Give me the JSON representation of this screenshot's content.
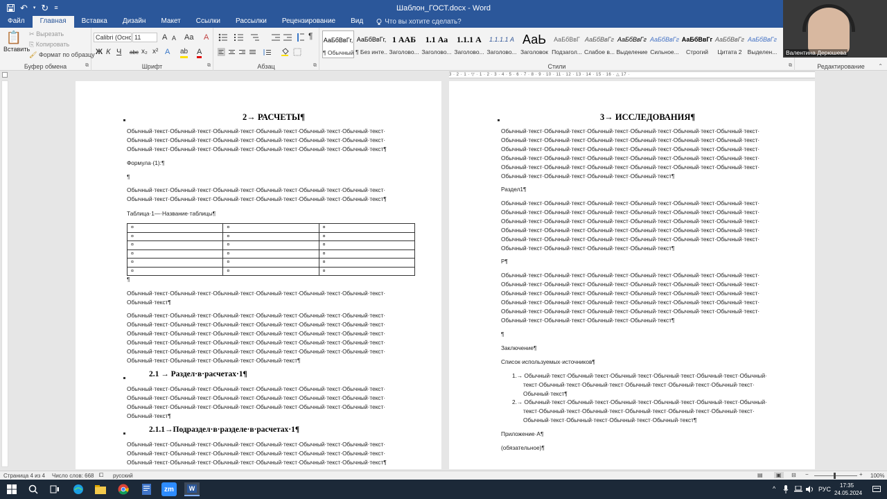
{
  "window": {
    "title": "Шаблон_ГОСТ.docx - Word"
  },
  "qat": {
    "save_icon": "save-icon",
    "undo_icon": "undo-icon",
    "redo_icon": "redo-icon",
    "customize_icon": "customize-icon",
    "undo_glyph": "↶",
    "redo_glyph": "↻",
    "customize_glyph": "≡"
  },
  "tabs": [
    {
      "label": "Файл"
    },
    {
      "label": "Главная"
    },
    {
      "label": "Вставка"
    },
    {
      "label": "Дизайн"
    },
    {
      "label": "Макет"
    },
    {
      "label": "Ссылки"
    },
    {
      "label": "Рассылки"
    },
    {
      "label": "Рецензирование"
    },
    {
      "label": "Вид"
    }
  ],
  "tellme": {
    "text": "Что вы хотите сделать?",
    "icon": "lightbulb-icon"
  },
  "ribbon": {
    "clipboard": {
      "label": "Буфер обмена",
      "paste": "Вставить",
      "cut": "Вырезать",
      "copy": "Копировать",
      "format_painter": "Формат по образцу",
      "paste_glyph": "📋",
      "cut_glyph": "✂",
      "copy_glyph": "⎘",
      "painter_glyph": "🖌"
    },
    "font": {
      "label": "Шрифт",
      "font_name": "Calibri (Осно",
      "font_size": "11",
      "grow": "A",
      "shrink": "A",
      "case": "Aa",
      "clear": "A",
      "bold": "Ж",
      "italic": "К",
      "underline": "Ч",
      "strike": "abc",
      "sub": "x₂",
      "sup": "x²",
      "effects": "A",
      "highlight": "ab",
      "color": "A"
    },
    "paragraph": {
      "label": "Абзац",
      "pilcrow": "¶"
    },
    "styles": {
      "label": "Стили",
      "items": [
        {
          "sample": "АаБбВвГг,",
          "name": "¶ Обычный"
        },
        {
          "sample": "АаБбВвГг,",
          "name": "¶ Без инте..."
        },
        {
          "sample": "1 ААБ",
          "name": "Заголово..."
        },
        {
          "sample": "1.1 Аа",
          "name": "Заголово..."
        },
        {
          "sample": "1.1.1 А",
          "name": "Заголово..."
        },
        {
          "sample": "1.1.1.1 А",
          "name": "Заголово..."
        },
        {
          "sample": "АаЬ",
          "name": "Заголовок"
        },
        {
          "sample": "АаБбВвГ",
          "name": "Подзагол..."
        },
        {
          "sample": "АаБбВвГг",
          "name": "Слабое в..."
        },
        {
          "sample": "АаБбВвГг",
          "name": "Выделение"
        },
        {
          "sample": "АаБбВвГг",
          "name": "Сильное..."
        },
        {
          "sample": "АаБбВвГг",
          "name": "Строгий"
        },
        {
          "sample": "АаБбВвГг",
          "name": "Цитата 2"
        },
        {
          "sample": "АаБбВвГг",
          "name": "Выделен..."
        }
      ]
    },
    "editing": {
      "label": "Редактирование"
    }
  },
  "ruler": {
    "text": "3 · 2 · 1 · ▽ · 1 · 2 · 3 · 4 · 5 · 6 · 7 · 8 · 9 · 10 · 11 · 12 · 13 · 14 · 15 · 16 · △ 17 ·"
  },
  "page1": {
    "heading": "2→ РАСЧЕТЫ¶",
    "p1": [
      "Обычный·текст·Обычный·текст·Обычный·текст·Обычный·текст·Обычный·текст·Обычный·текст·",
      "Обычный·текст·Обычный·текст·Обычный·текст·Обычный·текст·Обычный·текст·Обычный·текст·",
      "Обычный·текст·Обычный·текст·Обычный·текст·Обычный·текст·Обычный·текст·Обычный·текст¶"
    ],
    "formula": "Формула·(1):¶",
    "empty": "¶",
    "p2": [
      "Обычный·текст·Обычный·текст·Обычный·текст·Обычный·текст·Обычный·текст·Обычный·текст·",
      "Обычный·текст·Обычный·текст·Обычный·текст·Обычный·текст·Обычный·текст·Обычный·текст¶"
    ],
    "table_caption": "Таблица·1—·Название·таблицы¶",
    "cell_mark": "¤",
    "after_table": "¶",
    "p3": [
      "Обычный·текст·Обычный·текст·Обычный·текст·Обычный·текст·Обычный·текст·Обычный·текст·",
      "Обычный·текст¶"
    ],
    "p4": [
      "Обычный·текст·Обычный·текст·Обычный·текст·Обычный·текст·Обычный·текст·Обычный·текст·",
      "Обычный·текст·Обычный·текст·Обычный·текст·Обычный·текст·Обычный·текст·Обычный·текст·",
      "Обычный·текст·Обычный·текст·Обычный·текст·Обычный·текст·Обычный·текст·Обычный·текст·",
      "Обычный·текст·Обычный·текст·Обычный·текст·Обычный·текст·Обычный·текст·Обычный·текст·",
      "Обычный·текст·Обычный·текст·Обычный·текст·Обычный·текст·Обычный·текст·Обычный·текст·",
      "Обычный·текст·Обычный·текст·Обычный·текст·Обычный·текст¶"
    ],
    "h2": "2.1 → Раздел·в·расчетах·1¶",
    "p5": [
      "Обычный·текст·Обычный·текст·Обычный·текст·Обычный·текст·Обычный·текст·Обычный·текст·",
      "Обычный·текст·Обычный·текст·Обычный·текст·Обычный·текст·Обычный·текст·Обычный·текст·",
      "Обычный·текст·Обычный·текст·Обычный·текст·Обычный·текст·Обычный·текст·Обычный·текст·",
      "Обычный·текст¶"
    ],
    "h3": "2.1.1→Подраздел·в·разделе·в·расчетах·1¶",
    "p6": [
      "Обычный·текст·Обычный·текст·Обычный·текст·Обычный·текст·Обычный·текст·Обычный·текст·",
      "Обычный·текст·Обычный·текст·Обычный·текст·Обычный·текст·Обычный·текст·Обычный·текст·",
      "Обычный·текст·Обычный·текст·Обычный·текст·Обычный·текст·Обычный·текст·Обычный·текст¶"
    ]
  },
  "page2": {
    "heading": "3→ ИССЛЕДОВАНИЯ¶",
    "p1": [
      "Обычный·текст·Обычный·текст·Обычный·текст·Обычный·текст·Обычный·текст·Обычный·текст·",
      "Обычный·текст·Обычный·текст·Обычный·текст·Обычный·текст·Обычный·текст·Обычный·текст·",
      "Обычный·текст·Обычный·текст·Обычный·текст·Обычный·текст·Обычный·текст·Обычный·текст·",
      "Обычный·текст·Обычный·текст·Обычный·текст·Обычный·текст·Обычный·текст·Обычный·текст·",
      "Обычный·текст·Обычный·текст·Обычный·текст·Обычный·текст·Обычный·текст·Обычный·текст·",
      "Обычный·текст·Обычный·текст·Обычный·текст·Обычный·текст¶"
    ],
    "section": "Раздел1¶",
    "p2": [
      "Обычный·текст·Обычный·текст·Обычный·текст·Обычный·текст·Обычный·текст·Обычный·текст·",
      "Обычный·текст·Обычный·текст·Обычный·текст·Обычный·текст·Обычный·текст·Обычный·текст·",
      "Обычный·текст·Обычный·текст·Обычный·текст·Обычный·текст·Обычный·текст·Обычный·текст·",
      "Обычный·текст·Обычный·текст·Обычный·текст·Обычный·текст·Обычный·текст·Обычный·текст·",
      "Обычный·текст·Обычный·текст·Обычный·текст·Обычный·текст·Обычный·текст·Обычный·текст·",
      "Обычный·текст·Обычный·текст·Обычный·текст·Обычный·текст¶"
    ],
    "cursor_line": "Р¶",
    "p3": [
      "Обычный·текст·Обычный·текст·Обычный·текст·Обычный·текст·Обычный·текст·Обычный·текст·",
      "Обычный·текст·Обычный·текст·Обычный·текст·Обычный·текст·Обычный·текст·Обычный·текст·",
      "Обычный·текст·Обычный·текст·Обычный·текст·Обычный·текст·Обычный·текст·Обычный·текст·",
      "Обычный·текст·Обычный·текст·Обычный·текст·Обычный·текст·Обычный·текст·Обычный·текст·",
      "Обычный·текст·Обычный·текст·Обычный·текст·Обычный·текст·Обычный·текст·Обычный·текст·",
      "Обычный·текст·Обычный·текст·Обычный·текст·Обычный·текст¶"
    ],
    "empty": "¶",
    "conclusion": "Заключение¶",
    "sources": "Список·используемых·источников¶",
    "list": [
      [
        "1.→ Обычный·текст·Обычный·текст·Обычный·текст·Обычный·текст·Обычный·текст·Обычный·",
        "текст·Обычный·текст·Обычный·текст·Обычный·текст·Обычный·текст·Обычный·текст·",
        "Обычный·текст¶"
      ],
      [
        "2.→ Обычный·текст·Обычный·текст·Обычный·текст·Обычный·текст·Обычный·текст·Обычный·",
        "текст·Обычный·текст·Обычный·текст·Обычный·текст·Обычный·текст·Обычный·текст·",
        "Обычный·текст·Обычный·текст·Обычный·текст·Обычный·текст¶"
      ]
    ],
    "appendix": "Приложение·А¶",
    "mandatory": "(обязательное)¶"
  },
  "status": {
    "page": "Страница 4 из 4",
    "words": "Число слов: 668",
    "lang": "русский",
    "zoom": "100%"
  },
  "taskbar": {
    "lang": "РУС",
    "time": "17:35",
    "date": "24.05.2024",
    "zoom_glyph": "zm",
    "word_glyph": "W"
  },
  "webcam": {
    "name": "Валентина Дерюшева"
  }
}
